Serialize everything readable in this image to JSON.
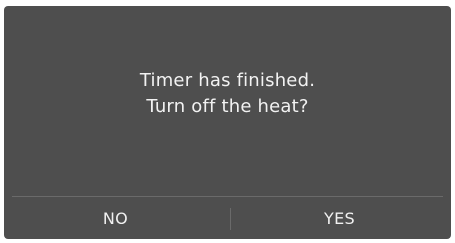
{
  "dialog": {
    "message_line1": "Timer has finished.",
    "message_line2": "Turn off the heat?",
    "no_label": "NO",
    "yes_label": "YES"
  },
  "colors": {
    "dialog_background": "#4e4e4e",
    "text": "#f2f2f2",
    "divider": "#6a6a6a"
  }
}
